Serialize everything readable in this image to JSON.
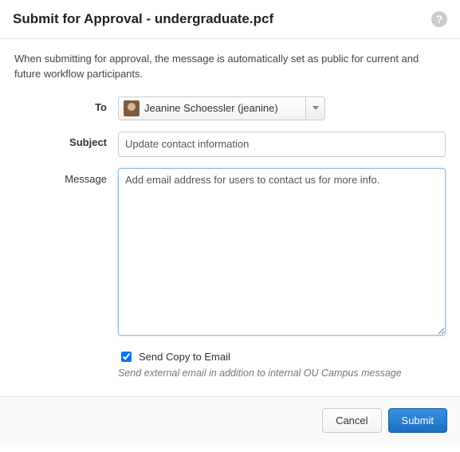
{
  "header": {
    "title": "Submit for Approval - undergraduate.pcf"
  },
  "info": "When submitting for approval, the message is automatically set as public for current and future workflow participants.",
  "form": {
    "to_label": "To",
    "to_value": "Jeanine Schoessler (jeanine)",
    "subject_label": "Subject",
    "subject_value": "Update contact information",
    "message_label": "Message",
    "message_value": "Add email address for users to contact us for more info.",
    "send_copy_label": "Send Copy to Email",
    "send_copy_checked": true,
    "send_copy_hint": "Send external email in addition to internal OU Campus message"
  },
  "footer": {
    "cancel": "Cancel",
    "submit": "Submit"
  }
}
